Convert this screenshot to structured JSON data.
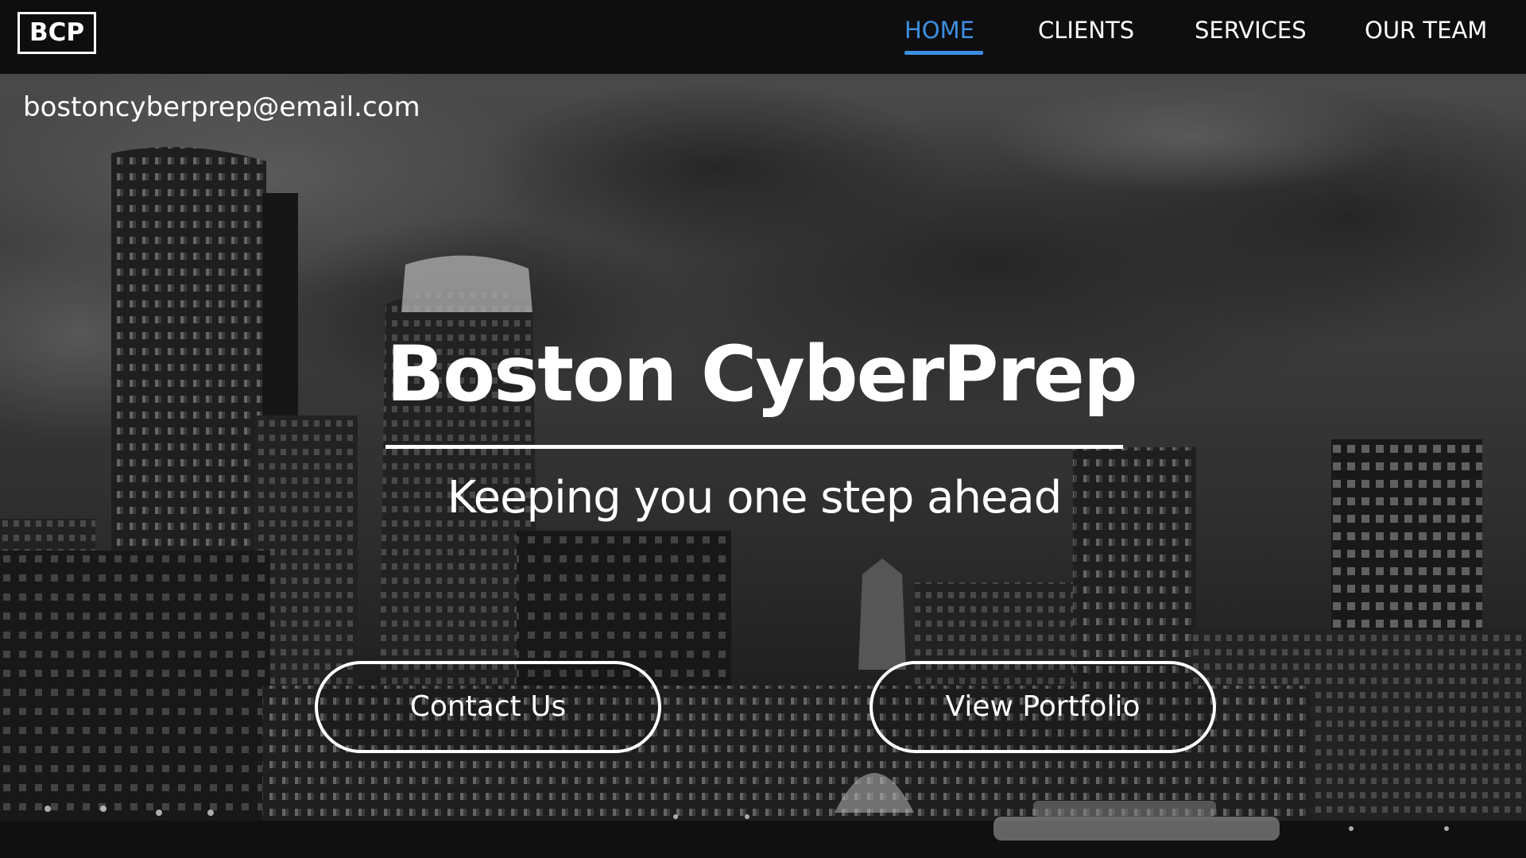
{
  "brand": {
    "logo_text": "BCP"
  },
  "nav": {
    "items": [
      {
        "label": "HOME",
        "active": true
      },
      {
        "label": "CLIENTS",
        "active": false
      },
      {
        "label": "SERVICES",
        "active": false
      },
      {
        "label": "OUR TEAM",
        "active": false
      }
    ],
    "active_color": "#3d8fe0"
  },
  "hero": {
    "email": "bostoncyberprep@email.com",
    "title": "Boston CyberPrep",
    "subtitle": "Keeping you one step ahead",
    "background_image": "night-city-skyline-grayscale",
    "buttons": {
      "contact_label": "Contact Us",
      "portfolio_label": "View Portfolio"
    }
  }
}
